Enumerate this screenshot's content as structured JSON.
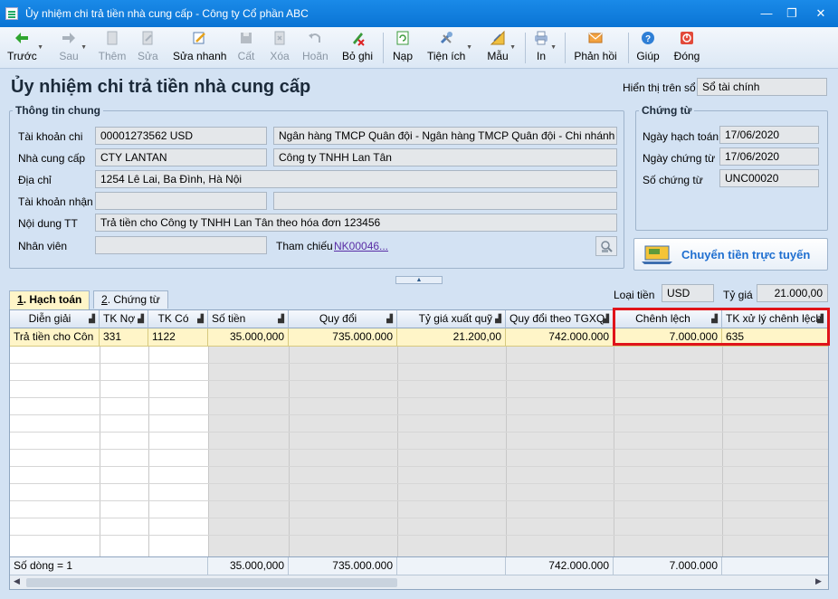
{
  "window": {
    "title": "Ủy nhiệm chi trả tiền nhà cung cấp - Công ty Cổ phần ABC"
  },
  "toolbar": {
    "items": [
      {
        "label": "Trước",
        "icon": "arrow-left-icon",
        "enabled": true
      },
      {
        "label": "Sau",
        "icon": "arrow-right-icon",
        "enabled": false
      },
      {
        "label": "Thêm",
        "icon": "add-document-icon",
        "enabled": false
      },
      {
        "label": "Sửa",
        "icon": "edit-document-icon",
        "enabled": false
      },
      {
        "label": "Sửa nhanh",
        "icon": "quick-edit-icon",
        "enabled": true
      },
      {
        "label": "Cất",
        "icon": "save-icon",
        "enabled": false
      },
      {
        "label": "Xóa",
        "icon": "delete-icon",
        "enabled": false
      },
      {
        "label": "Hoãn",
        "icon": "undo-icon",
        "enabled": false
      },
      {
        "label": "Bỏ ghi",
        "icon": "unpost-icon",
        "enabled": true
      },
      {
        "label": "Nạp",
        "icon": "reload-icon",
        "enabled": true
      },
      {
        "label": "Tiện ích",
        "icon": "tools-icon",
        "enabled": true
      },
      {
        "label": "Mẫu",
        "icon": "template-icon",
        "enabled": true
      },
      {
        "label": "In",
        "icon": "print-icon",
        "enabled": true
      },
      {
        "label": "Phản hồi",
        "icon": "mail-icon",
        "enabled": true
      },
      {
        "label": "Giúp",
        "icon": "help-icon",
        "enabled": true
      },
      {
        "label": "Đóng",
        "icon": "close-icon",
        "enabled": true
      }
    ]
  },
  "form": {
    "title": "Ủy nhiệm chi trả tiền nhà cung cấp",
    "display_label": "Hiển thị trên sổ",
    "display_value": "Sổ tài chính",
    "general": {
      "title": "Thông tin chung",
      "account_label": "Tài khoản chi",
      "account_value": "00001273562 USD",
      "bank_value": "Ngân hàng TMCP Quân đội  - Ngân hàng TMCP Quân đội - Chi nhánh Th",
      "supplier_label": "Nhà cung cấp",
      "supplier_code": "CTY LANTAN",
      "supplier_name": "Công ty TNHH Lan Tân",
      "address_label": "Địa chỉ",
      "address_value": "1254 Lê Lai, Ba Đình, Hà Nội",
      "recv_account_label": "Tài khoản nhận",
      "recv_account_value": "",
      "recv_bank_value": "",
      "content_label": "Nội dung TT",
      "content_value": "Trả tiền cho Công ty TNHH Lan Tân theo hóa đơn 123456",
      "employee_label": "Nhân viên",
      "employee_value": "",
      "reference_label": "Tham chiếu",
      "reference_value": "NK00046",
      "reference_more": "..."
    },
    "voucher": {
      "title": "Chứng từ",
      "post_date_label": "Ngày hạch toán",
      "post_date_value": "17/06/2020",
      "voucher_date_label": "Ngày chứng từ",
      "voucher_date_value": "17/06/2020",
      "voucher_no_label": "Số chứng từ",
      "voucher_no_value": "UNC00020"
    },
    "online_button": "Chuyển tiền trực tuyến",
    "currency_label": "Loại tiền",
    "currency_value": "USD",
    "rate_label": "Tỷ giá",
    "rate_value": "21.000,00"
  },
  "tabs": [
    {
      "key": "1",
      "label": ". Hạch toán",
      "active": true
    },
    {
      "key": "2",
      "label": ". Chứng từ",
      "active": false
    }
  ],
  "grid": {
    "columns": [
      "Diễn giải",
      "TK Nợ",
      "TK Có",
      "Số tiền",
      "Quy đổi",
      "Tỷ giá xuất quỹ",
      "Quy đổi theo TGXQ",
      "Chênh lệch",
      "TK xử lý chênh lệch"
    ],
    "rows": [
      [
        "Trả tiền cho Côn",
        "331",
        "1122",
        "35.000,000",
        "735.000.000",
        "21.200,00",
        "742.000.000",
        "7.000.000",
        "635"
      ]
    ],
    "footer": {
      "row_count": "Số dòng = 1",
      "amount": "35.000,000",
      "converted": "735.000.000",
      "converted_tgxq": "742.000.000",
      "difference": "7.000.000"
    }
  },
  "colors": {
    "highlight": "#e0141a",
    "selected_row": "#fff5c8",
    "titlebar": "#0a74d4"
  }
}
